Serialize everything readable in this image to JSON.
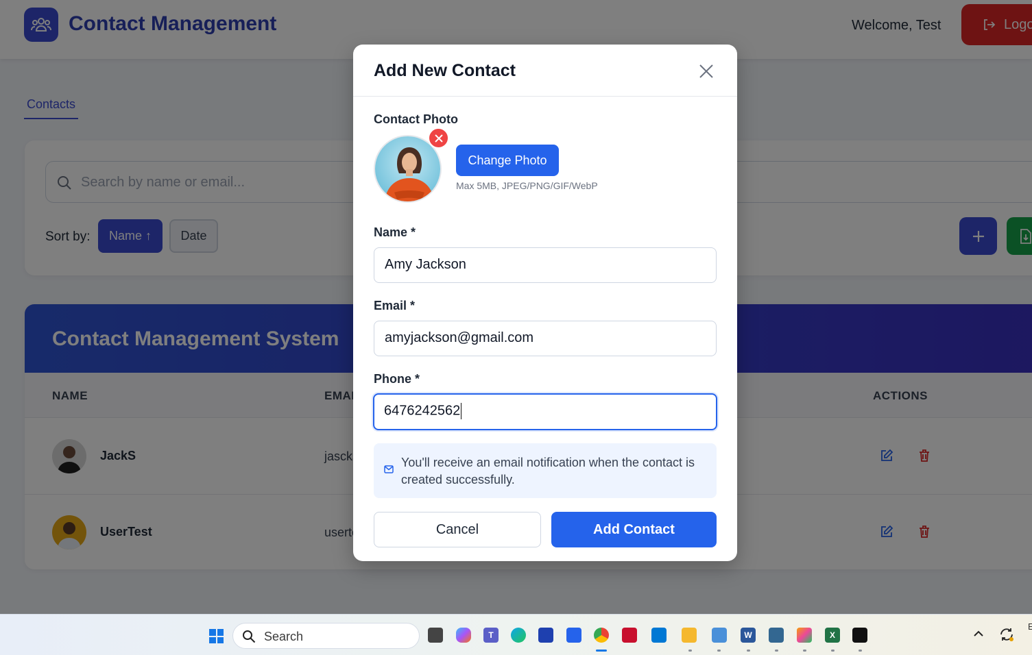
{
  "header": {
    "app_title": "Contact Management",
    "welcome": "Welcome, Test",
    "logout_label": "Logout"
  },
  "tabs": [
    "Contacts"
  ],
  "search": {
    "placeholder": "Search by name or email..."
  },
  "sort": {
    "label": "Sort by:",
    "name_label": "Name ↑",
    "date_label": "Date"
  },
  "table": {
    "banner_title": "Contact Management System",
    "columns": {
      "name": "NAME",
      "email": "EMAIL",
      "actions": "ACTIONS"
    },
    "rows": [
      {
        "name": "JackS",
        "email": "jascks@example.com"
      },
      {
        "name": "UserTest",
        "email": "usertest@example.com"
      }
    ]
  },
  "modal": {
    "title": "Add New Contact",
    "photo_label": "Contact Photo",
    "change_photo": "Change Photo",
    "photo_hint": "Max 5MB, JPEG/PNG/GIF/WebP",
    "name_label": "Name *",
    "name_value": "Amy Jackson",
    "email_label": "Email *",
    "email_value": "amyjackson@gmail.com",
    "phone_label": "Phone *",
    "phone_value": "6476242562",
    "notice": "You'll receive an email notification when the contact is created successfully.",
    "cancel": "Cancel",
    "submit": "Add Contact"
  },
  "taskbar": {
    "search_label": "Search",
    "tray_text": "E"
  },
  "colors": {
    "primary": "#3b4bd0",
    "accent": "#2563eb",
    "danger": "#dc2626",
    "success": "#16a34a"
  }
}
